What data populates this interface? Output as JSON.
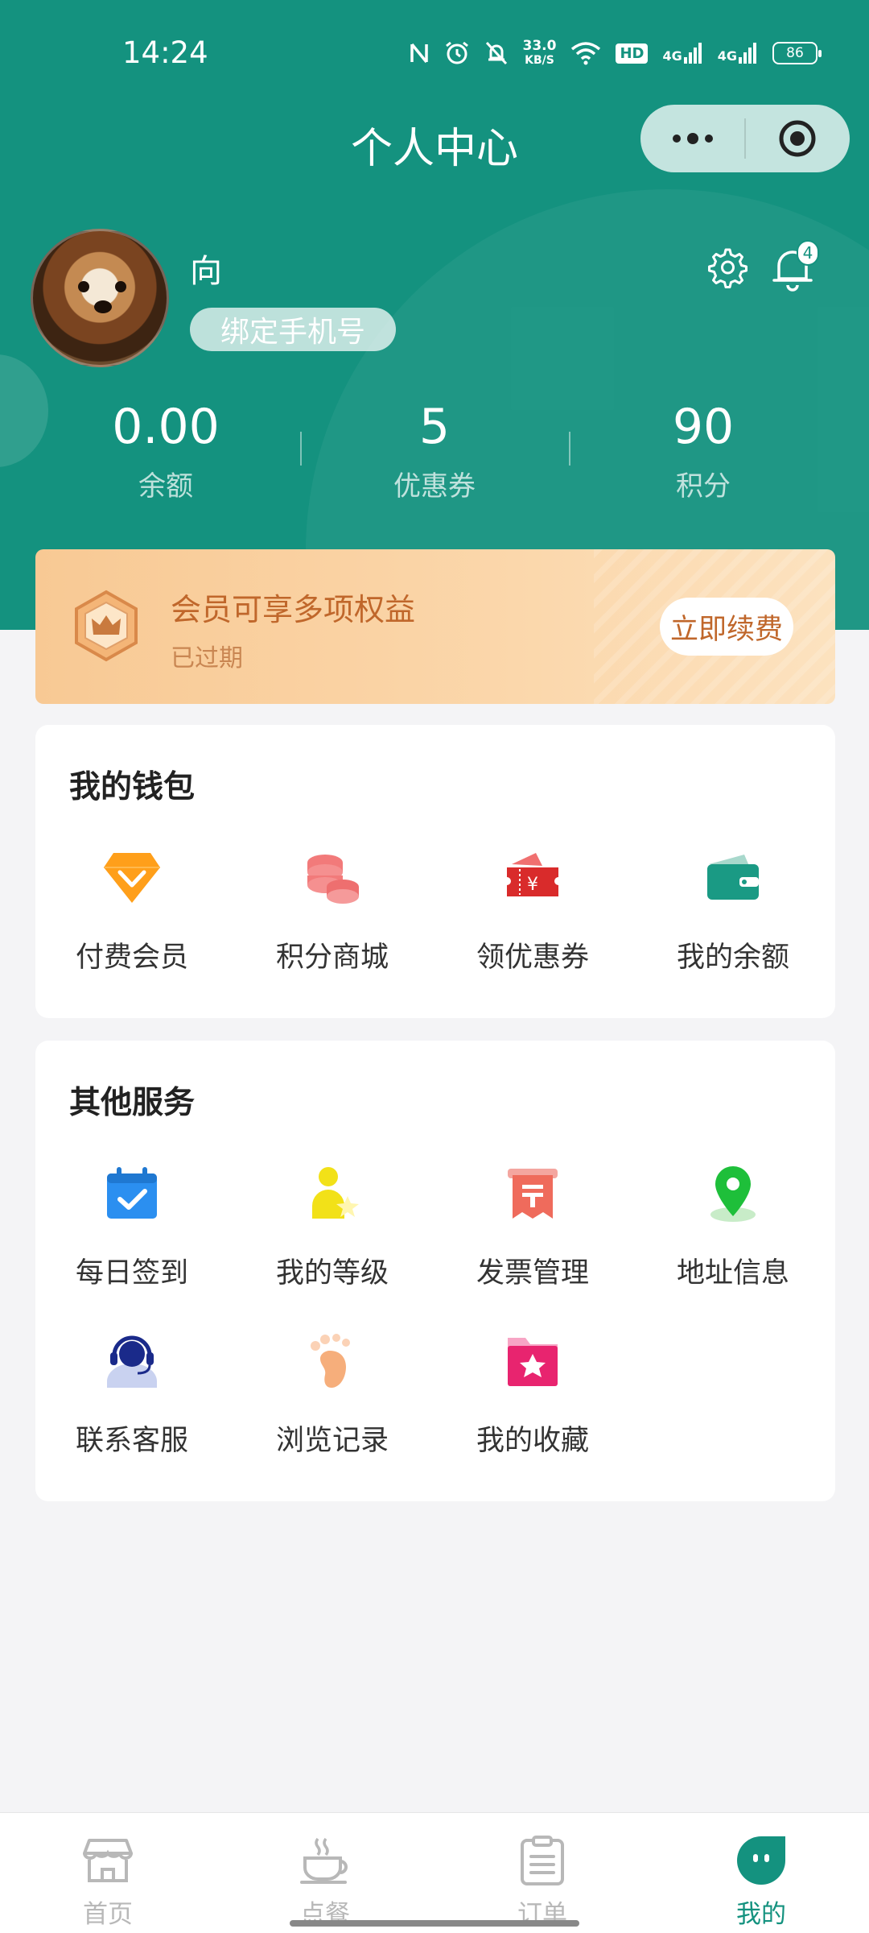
{
  "status_bar": {
    "time": "14:24",
    "speed_value": "33.0",
    "speed_unit": "KB/S",
    "hd": "HD",
    "net1": "4G",
    "net2": "4G",
    "battery": "86"
  },
  "header": {
    "title": "个人中心"
  },
  "profile": {
    "name": "向",
    "bind_phone_label": "绑定手机号",
    "notification_count": "4"
  },
  "stats": [
    {
      "value": "0.00",
      "label": "余额"
    },
    {
      "value": "5",
      "label": "优惠券"
    },
    {
      "value": "90",
      "label": "积分"
    }
  ],
  "member": {
    "title": "会员可享多项权益",
    "status": "已过期",
    "renew_label": "立即续费"
  },
  "wallet": {
    "title": "我的钱包",
    "items": [
      {
        "label": "付费会员",
        "icon": "diamond-icon"
      },
      {
        "label": "积分商城",
        "icon": "coins-icon"
      },
      {
        "label": "领优惠券",
        "icon": "coupon-icon"
      },
      {
        "label": "我的余额",
        "icon": "wallet-icon"
      }
    ]
  },
  "services": {
    "title": "其他服务",
    "items": [
      {
        "label": "每日签到",
        "icon": "calendar-check-icon"
      },
      {
        "label": "我的等级",
        "icon": "user-star-icon"
      },
      {
        "label": "发票管理",
        "icon": "invoice-icon"
      },
      {
        "label": "地址信息",
        "icon": "location-pin-icon"
      },
      {
        "label": "联系客服",
        "icon": "customer-service-icon"
      },
      {
        "label": "浏览记录",
        "icon": "footprint-icon"
      },
      {
        "label": "我的收藏",
        "icon": "star-folder-icon"
      }
    ]
  },
  "tabbar": {
    "items": [
      {
        "label": "首页",
        "icon": "store-icon"
      },
      {
        "label": "点餐",
        "icon": "coffee-cup-icon"
      },
      {
        "label": "订单",
        "icon": "order-list-icon"
      },
      {
        "label": "我的",
        "icon": "profile-face-icon"
      }
    ],
    "active": "我的"
  },
  "colors": {
    "brand": "#14927f",
    "member_text": "#c0672b",
    "inactive_tab": "#b8b8b8"
  }
}
